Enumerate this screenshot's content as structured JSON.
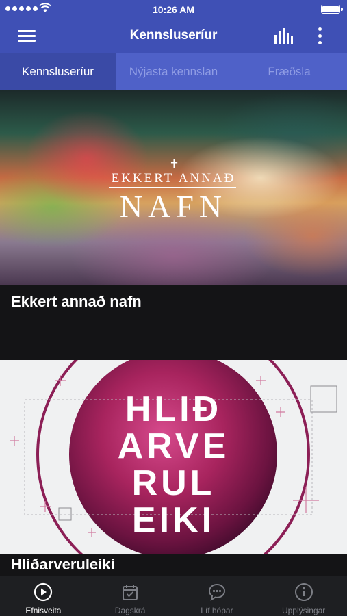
{
  "status_bar": {
    "time": "10:26 AM",
    "signal_icon": "signal-dots-icon",
    "wifi_icon": "wifi-icon",
    "battery_icon": "battery-icon",
    "battery_level": 1.0
  },
  "app_bar": {
    "title": "Kennsluseríur",
    "menu_icon": "hamburger-menu-icon",
    "audio_icon": "audio-bars-icon",
    "more_icon": "more-vertical-icon",
    "color": "#3f50b5"
  },
  "tabs": [
    {
      "label": "Kennsluseríur",
      "active": true
    },
    {
      "label": "Nýjasta kennslan",
      "active": false
    },
    {
      "label": "Fræðsla",
      "active": false
    }
  ],
  "series": [
    {
      "title": "Ekkert annað nafn",
      "art_top": "EKKERT ANNAÐ",
      "art_bottom": "NAFN"
    },
    {
      "title": "Hliðarveruleiki",
      "art_lines": [
        "HLIÐ",
        "ARVE",
        "RUL",
        "EIKI"
      ]
    }
  ],
  "bottom_nav": [
    {
      "label": "Efnisveita",
      "icon": "play-circle-icon",
      "active": true
    },
    {
      "label": "Dagskrá",
      "icon": "calendar-check-icon",
      "active": false
    },
    {
      "label": "Líf hópar",
      "icon": "chat-bubble-icon",
      "active": false
    },
    {
      "label": "Upplýsingar",
      "icon": "info-circle-icon",
      "active": false
    }
  ],
  "colors": {
    "accent": "#3f50b5",
    "tab_active": "#3a4aa6",
    "tab_bar": "#4f61c8",
    "background": "#141416",
    "nav_background": "#1e1f22"
  }
}
